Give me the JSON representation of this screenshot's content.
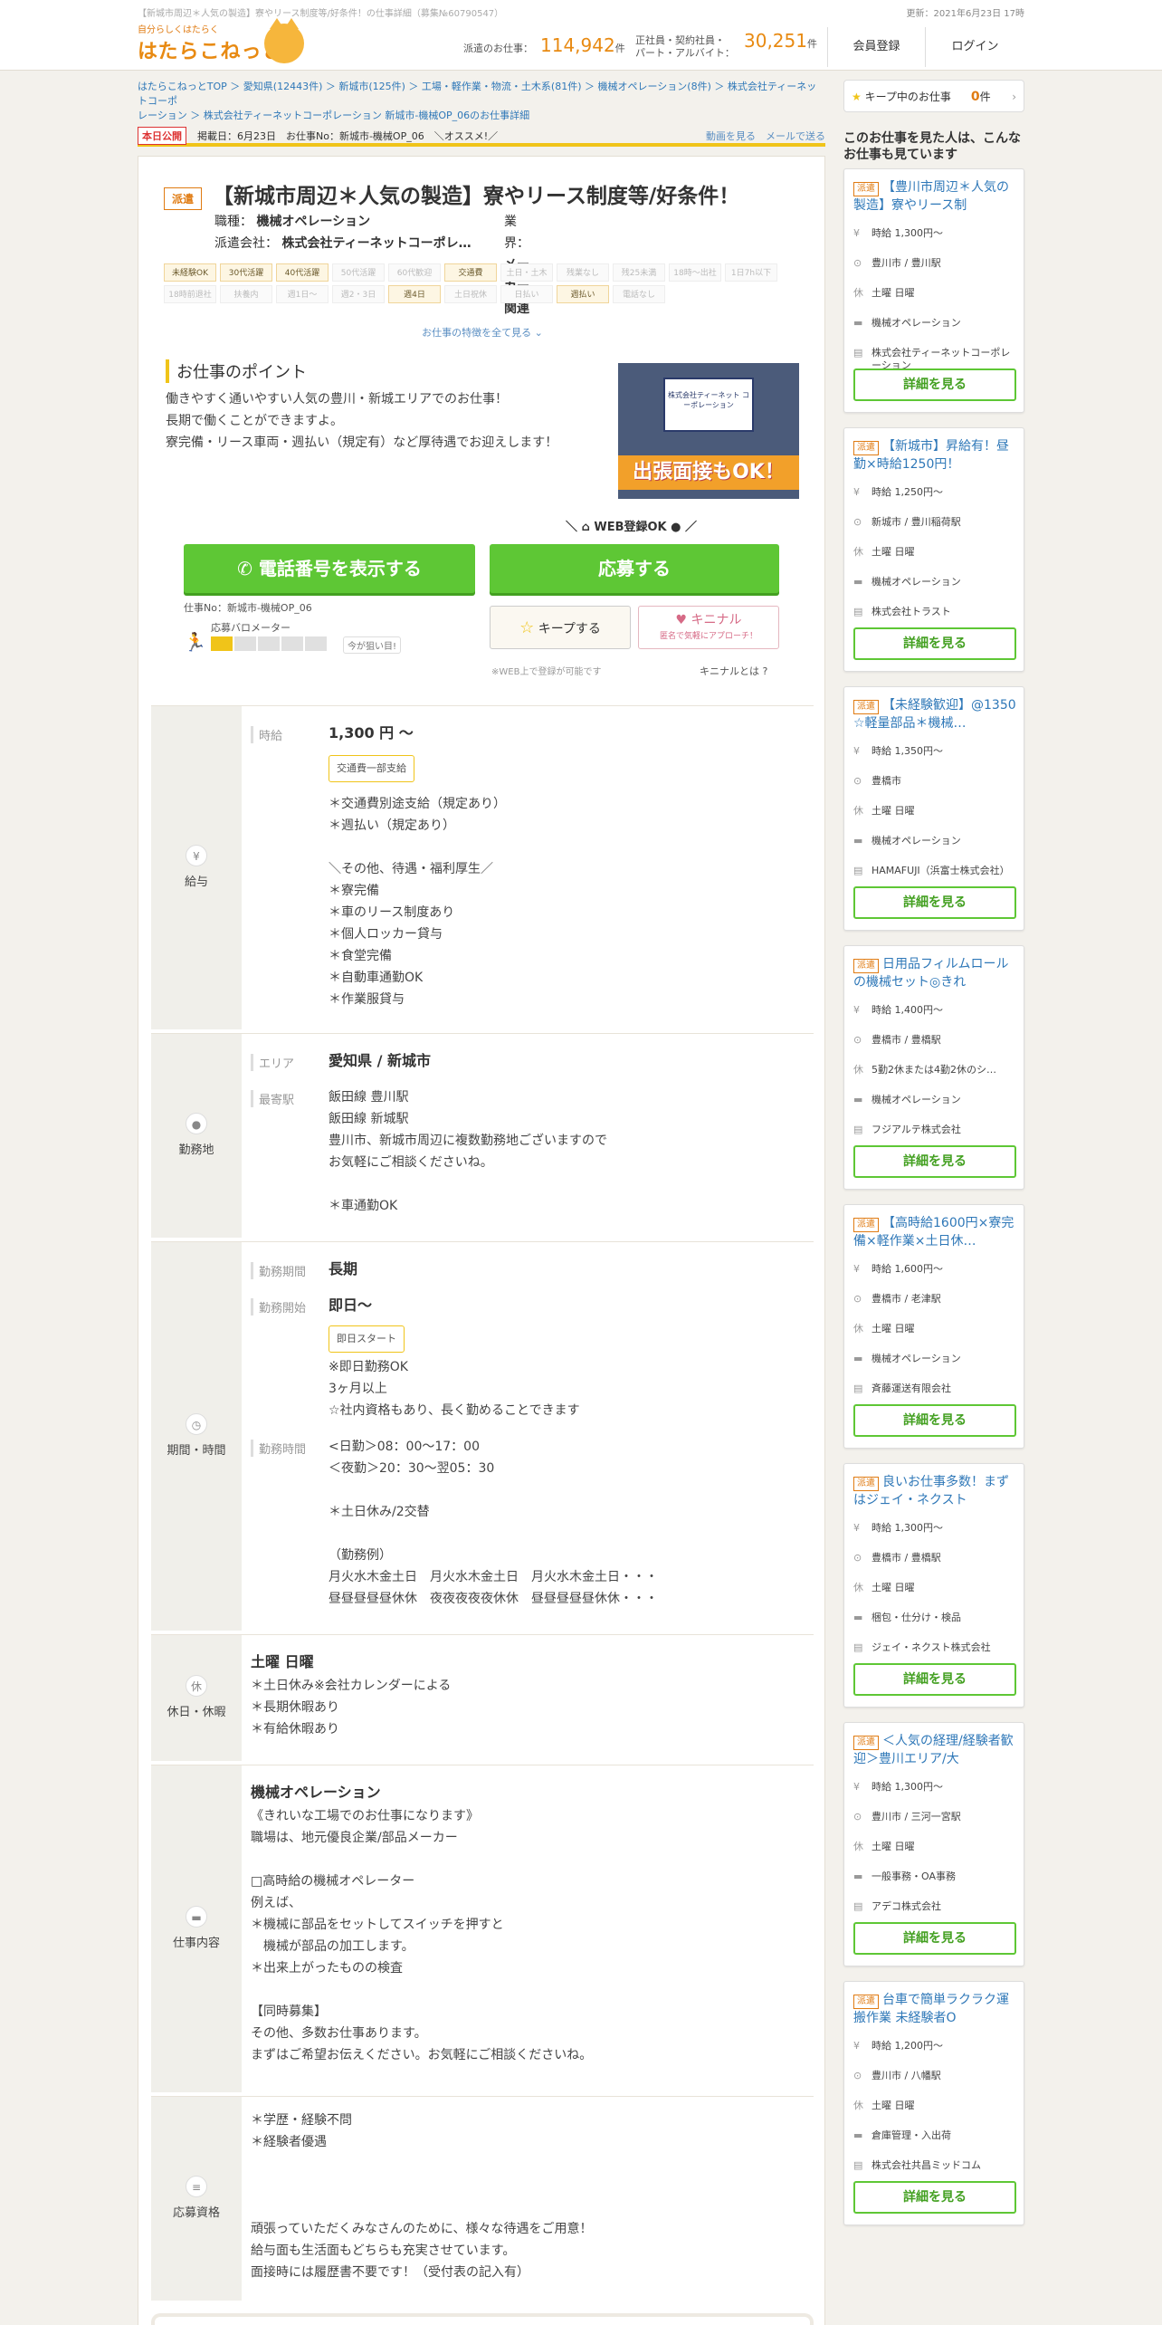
{
  "header": {
    "seo_text": "【新城市周辺＊人気の製造】寮やリース制度等/好条件！の仕事詳細（募集№60790547）",
    "updated": "更新：2021年6月23日 17時",
    "logo_small": "自分らしくはたらく",
    "logo_big": "はたらこねっと",
    "dispatch_label": "派遣のお仕事：",
    "dispatch_count": "114,942",
    "dispatch_unit": "件",
    "other_label_1": "正社員・契約社員・",
    "other_label_2": "パート・アルバイト：",
    "other_count": "30,251",
    "other_unit": "件",
    "register": "会員登録",
    "login": "ログイン"
  },
  "breadcrumb": {
    "line1": "はたらこねっとTOP ＞ 愛知県(12443件) ＞ 新城市(125件) ＞ 工場・軽作業・物流・土木系(81件) ＞ 機械オペレーション(8件) ＞ 株式会社ティーネットコーポ",
    "line2": "レーション ＞ 株式会社ティーネットコーポレーション 新城市-機械OP_06のお仕事詳細"
  },
  "infobar": {
    "today": "本日公開",
    "posted": "掲載日：6月23日　お仕事No：新城市-機械OP_06　＼オススメ!／",
    "video": "動画を見る",
    "mail": "メールで送る"
  },
  "job": {
    "type_tag": "派遣",
    "title": "【新城市周辺＊人気の製造】寮やリース制度等/好条件！",
    "occupation_label": "職種：",
    "occupation": "機械オペレーション",
    "industry_label": "業界：",
    "industry": "メーカー関連",
    "company_label": "派遣会社：",
    "company": "株式会社ティーネットコーポレ…",
    "features": [
      {
        "t": "未経験OK",
        "on": true
      },
      {
        "t": "30代活躍",
        "on": true
      },
      {
        "t": "40代活躍",
        "on": true
      },
      {
        "t": "50代活躍",
        "on": false
      },
      {
        "t": "60代歓迎",
        "on": false
      },
      {
        "t": "交通費",
        "on": true
      },
      {
        "t": "土日・土木",
        "on": false
      },
      {
        "t": "残業なし",
        "on": false
      },
      {
        "t": "残25未満",
        "on": false
      },
      {
        "t": "18時～出社",
        "on": false
      },
      {
        "t": "1日7h以下",
        "on": false
      },
      {
        "t": "18時前退社",
        "on": false
      },
      {
        "t": "扶養内",
        "on": false
      },
      {
        "t": "週1日～",
        "on": false
      },
      {
        "t": "週2・3日",
        "on": false
      },
      {
        "t": "週4日",
        "on": true
      },
      {
        "t": "土日祝休",
        "on": false
      },
      {
        "t": "日払い",
        "on": false
      },
      {
        "t": "週払い",
        "on": true
      },
      {
        "t": "電話なし",
        "on": false
      }
    ],
    "more_features": "お仕事の特徴を全て見る ⌄",
    "point_title": "お仕事のポイント",
    "point_lines": [
      "働きやすく通いやすい人気の豊川・新城エリアでのお仕事！",
      "長期で働くことができますよ。",
      "寮完備・リース車両・週払い（規定有）など厚待遇でお迎えします！"
    ],
    "photo_sign": "株式会社ティーネット コーポレーション",
    "photo_banner": "出張面接もOK！",
    "web_ok": "＼ ⌂ WEB登録OK ● ／",
    "tel_button": "✆ 電話番号を表示する",
    "apply_button": "応募する",
    "job_no": "仕事No：新城市-機械OP_06",
    "barometer_label": "応募バロメーター",
    "barometer_level": 1,
    "barometer_total": 5,
    "barometer_note": "今が狙い目!",
    "keep_button": "キープする",
    "kinal_title": "キニナル",
    "kinal_sub": "匿名で気軽にアプローチ！",
    "web_note": "※WEB上で登録が可能です",
    "kinal_what": "キニナルとは ?"
  },
  "salary": {
    "label": "給与",
    "icon": "¥",
    "key": "時給",
    "amount": "1,300 円 ～",
    "pill": "交通費一部支給",
    "lines": [
      "＊交通費別途支給（規定あり）",
      "＊週払い（規定あり）",
      "",
      "＼その他、待遇・福利厚生／",
      "＊寮完備",
      "＊車のリース制度あり",
      "＊個人ロッカー貸与",
      "＊食堂完備",
      "＊自動車通勤OK",
      "＊作業服貸与"
    ]
  },
  "location": {
    "label": "勤務地",
    "icon": "●",
    "area_key": "エリア",
    "area": "愛知県 / 新城市",
    "station_key": "最寄駅",
    "lines": [
      "飯田線 豊川駅",
      "飯田線 新城駅",
      "豊川市、新城市周辺に複数勤務地ございますので",
      "お気軽にご相談くださいね。",
      "",
      "＊車通勤OK"
    ]
  },
  "period": {
    "label": "期間・時間",
    "icon": "◷",
    "period_key": "勤務期間",
    "period": "長期",
    "start_key": "勤務開始",
    "start": "即日～",
    "start_pill": "即日スタート",
    "start_lines": [
      "※即日勤務OK",
      "3ヶ月以上",
      "☆社内資格もあり、長く勤めることできます"
    ],
    "time_key": "勤務時間",
    "time_lines": [
      "<日勤＞08：00～17：00",
      "＜夜勤＞20：30～翌05：30",
      "",
      "＊土日休み/2交替",
      "",
      "（勤務例）",
      "月火水木金土日　月火水木金土日　月火水木金土日・・・",
      "昼昼昼昼昼休休　夜夜夜夜夜休休　昼昼昼昼昼休休・・・"
    ]
  },
  "holiday": {
    "label": "休日・休暇",
    "icon": "休",
    "title": "土曜 日曜",
    "lines": [
      "＊土日休み※会社カレンダーによる",
      "＊長期休暇あり",
      "＊有給休暇あり"
    ]
  },
  "content": {
    "label": "仕事内容",
    "icon": "▬",
    "title": "機械オペレーション",
    "lines": [
      "《きれいな工場でのお仕事になります》",
      "職場は、地元優良企業/部品メーカー",
      "",
      "□高時給の機械オペレーター",
      "例えば、",
      "＊機械に部品をセットしてスイッチを押すと",
      "　機械が部品の加工します。",
      "＊出来上がったものの検査",
      "",
      "【同時募集】",
      "その他、多数お仕事あります。",
      "まずはご希望お伝えください。お気軽にご相談くださいね。"
    ]
  },
  "qualification": {
    "label": "応募資格",
    "icon": "≡",
    "lines": [
      "＊学歴・経験不問",
      "＊経験者優遇",
      "",
      "",
      "",
      "頑張っていただくみなさんのために、様々な待遇をご用意！",
      "給与面も生活面もどちらも充実させています。",
      "面接時には履歴書不要です！（受付表の記入有）"
    ]
  },
  "sidebar": {
    "keep_label": "キープ中のお仕事",
    "keep_count": "0",
    "keep_unit": "件",
    "heading": "このお仕事を見た人は、こんなお仕事も見ています",
    "detail_label": "詳細を見る",
    "cards": [
      {
        "tag": "派遣",
        "title": "【豊川市周辺＊人気の製造】寮やリース制",
        "wage": "時給 1,300円～",
        "loc": "豊川市 / 豊川駅",
        "hol": "土曜 日曜",
        "job": "機械オペレーション",
        "co": "株式会社ティーネットコーポレーション"
      },
      {
        "tag": "派遣",
        "title": "【新城市】昇給有！昼勤×時給1250円！",
        "wage": "時給 1,250円～",
        "loc": "新城市 / 豊川稲荷駅",
        "hol": "土曜 日曜",
        "job": "機械オペレーション",
        "co": "株式会社トラスト"
      },
      {
        "tag": "派遣",
        "title": "【未経験歓迎】@1350　☆軽量部品＊機械…",
        "wage": "時給 1,350円～",
        "loc": "豊橋市",
        "hol": "土曜 日曜",
        "job": "機械オペレーション",
        "co": "HAMAFUJI（浜富士株式会社）"
      },
      {
        "tag": "派遣",
        "title": "日用品フィルムロールの機械セット◎きれ",
        "wage": "時給 1,400円～",
        "loc": "豊橋市 / 豊橋駅",
        "hol": "5勤2休または4勤2休のシ…",
        "job": "機械オペレーション",
        "co": "フジアルテ株式会社"
      },
      {
        "tag": "派遣",
        "title": "【高時給1600円×寮完備×軽作業×土日休…",
        "wage": "時給 1,600円～",
        "loc": "豊橋市 / 老津駅",
        "hol": "土曜 日曜",
        "job": "機械オペレーション",
        "co": "斉藤運送有限会社"
      },
      {
        "tag": "派遣",
        "title": "良いお仕事多数！まずはジェイ・ネクスト",
        "wage": "時給 1,300円～",
        "loc": "豊橋市 / 豊橋駅",
        "hol": "土曜 日曜",
        "job": "梱包・仕分け・検品",
        "co": "ジェイ・ネクスト株式会社"
      },
      {
        "tag": "派遣",
        "title": "＜人気の経理/経験者歓迎＞豊川エリア/大",
        "wage": "時給 1,300円～",
        "loc": "豊川市 / 三河一宮駅",
        "hol": "土曜 日曜",
        "job": "一般事務・OA事務",
        "co": "アデコ株式会社"
      },
      {
        "tag": "派遣",
        "title": "台車で簡単ラクラク運搬作業 未経験者O",
        "wage": "時給 1,200円～",
        "loc": "豊川市 / 八幡駅",
        "hol": "土曜 日曜",
        "job": "倉庫管理・入出荷",
        "co": "株式会社共昌ミッドコム"
      }
    ]
  }
}
